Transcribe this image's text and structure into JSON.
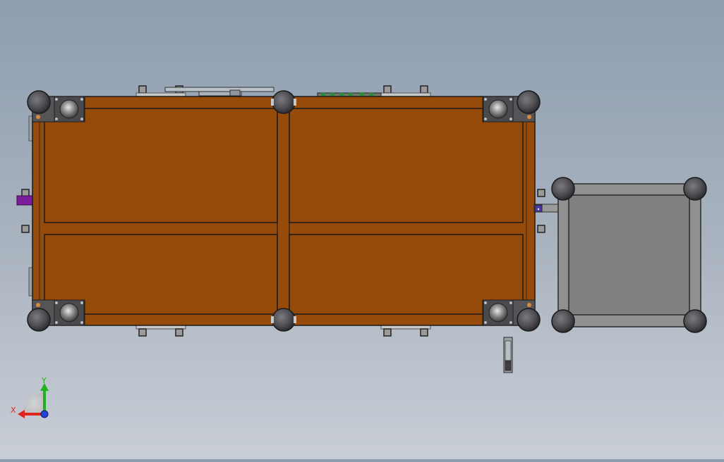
{
  "viewport": {
    "background_top": "#8e9db0",
    "background_bottom": "#c9ced6"
  },
  "model": {
    "frame_color": "#964b0a",
    "frame_edge": "#1b1b1b",
    "panel_color": "#954a08",
    "cart_color": "#808080",
    "cart_frame": "#909090",
    "caster_color": "#4f4f53",
    "bracket_color": "#5a5a5a",
    "accent_purple": "#7a1c9c",
    "panel_count": 4,
    "caster_count": 10
  },
  "triad": {
    "x_label": "X",
    "y_label": "Y",
    "x_color": "#e0241b",
    "y_color": "#1fb21f",
    "z_color": "#2343d8"
  }
}
